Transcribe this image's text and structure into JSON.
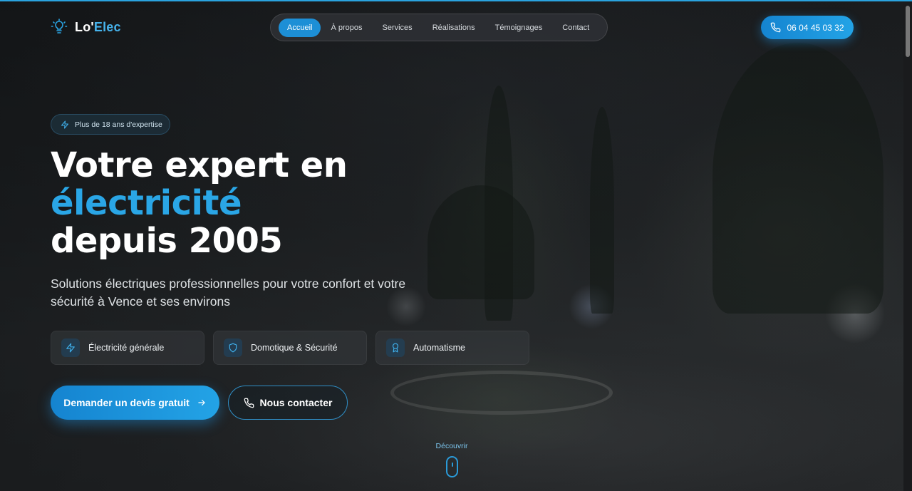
{
  "brand": {
    "name_main": "Lo'",
    "name_accent": "Elec",
    "icon": "lightbulb-icon"
  },
  "nav": {
    "items": [
      {
        "label": "Accueil",
        "active": true
      },
      {
        "label": "À propos"
      },
      {
        "label": "Services"
      },
      {
        "label": "Réalisations"
      },
      {
        "label": "Témoignages"
      },
      {
        "label": "Contact"
      }
    ]
  },
  "header": {
    "phone": "06 04 45 03 32",
    "phone_icon": "phone-icon"
  },
  "hero": {
    "badge": "Plus de 18 ans d'expertise",
    "title_line1": "Votre expert en",
    "title_accent": "électricité",
    "title_line3": "depuis 2005",
    "subtitle": "Solutions électriques professionnelles pour votre confort et votre sécurité à Vence et ses environs",
    "features": [
      {
        "label": "Électricité générale",
        "icon": "lightning-icon"
      },
      {
        "label": "Domotique & Sécurité",
        "icon": "shield-icon"
      },
      {
        "label": "Automatisme",
        "icon": "award-icon"
      }
    ],
    "cta_primary": "Demander un devis gratuit",
    "cta_secondary": "Nous contacter",
    "discover": "Découvrir"
  },
  "colors": {
    "accent": "#2aa6e6",
    "button": "#1d8fd6"
  }
}
